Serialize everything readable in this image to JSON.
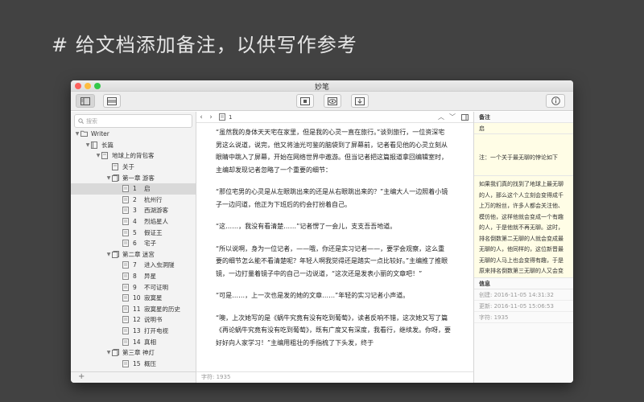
{
  "headline": "# 给文档添加备注，以供写作参考",
  "window": {
    "title": "妙笔"
  },
  "sidebar": {
    "search_placeholder": "搜索",
    "add_label": "+",
    "tree": [
      {
        "level": 0,
        "chev": "▼",
        "icon": "folder",
        "num": "",
        "label": "Writer",
        "selected": false
      },
      {
        "level": 1,
        "chev": "▼",
        "icon": "book",
        "num": "",
        "label": "长篇",
        "selected": false
      },
      {
        "level": 2,
        "chev": "▼",
        "icon": "doc",
        "num": "",
        "label": "地球上的背包客",
        "selected": false
      },
      {
        "level": 3,
        "chev": "",
        "icon": "doc",
        "num": "",
        "label": "关于",
        "selected": false
      },
      {
        "level": 3,
        "chev": "▼",
        "icon": "stack",
        "num": "",
        "label": "第一章  游客",
        "selected": false
      },
      {
        "level": 4,
        "chev": "",
        "icon": "page",
        "num": "1",
        "label": "启",
        "selected": true
      },
      {
        "level": 4,
        "chev": "",
        "icon": "page",
        "num": "2",
        "label": "杭州行",
        "selected": false
      },
      {
        "level": 4,
        "chev": "",
        "icon": "page",
        "num": "3",
        "label": "西湖游客",
        "selected": false
      },
      {
        "level": 4,
        "chev": "",
        "icon": "page",
        "num": "4",
        "label": "烈焰星人",
        "selected": false
      },
      {
        "level": 4,
        "chev": "",
        "icon": "page",
        "num": "5",
        "label": "假证王",
        "selected": false
      },
      {
        "level": 4,
        "chev": "",
        "icon": "page",
        "num": "6",
        "label": "宅子",
        "selected": false
      },
      {
        "level": 3,
        "chev": "▼",
        "icon": "stack",
        "num": "",
        "label": "第二章  迷宫",
        "selected": false
      },
      {
        "level": 4,
        "chev": "",
        "icon": "page",
        "num": "7",
        "label": "进入虫洞隧",
        "selected": false
      },
      {
        "level": 4,
        "chev": "",
        "icon": "page",
        "num": "8",
        "label": "异星",
        "selected": false
      },
      {
        "level": 4,
        "chev": "",
        "icon": "page",
        "num": "9",
        "label": "不可证明",
        "selected": false
      },
      {
        "level": 4,
        "chev": "",
        "icon": "page",
        "num": "10",
        "label": "寂寞星",
        "selected": false
      },
      {
        "level": 4,
        "chev": "",
        "icon": "page",
        "num": "11",
        "label": "寂寞星的历史",
        "selected": false
      },
      {
        "level": 4,
        "chev": "",
        "icon": "page",
        "num": "12",
        "label": "说明书",
        "selected": false
      },
      {
        "level": 4,
        "chev": "",
        "icon": "page",
        "num": "13",
        "label": "打开电视",
        "selected": false
      },
      {
        "level": 4,
        "chev": "",
        "icon": "page",
        "num": "14",
        "label": "真相",
        "selected": false
      },
      {
        "level": 3,
        "chev": "▼",
        "icon": "stack",
        "num": "",
        "label": "第三章  神灯",
        "selected": false
      },
      {
        "level": 4,
        "chev": "",
        "icon": "page",
        "num": "15",
        "label": "概压",
        "selected": false
      }
    ]
  },
  "editor": {
    "page_number": "1",
    "paragraphs": [
      "“虽然我的身体天天宅在家里，但是我的心灵一直在旅行。”谈到旅行，一位资深宅男这么说道，说完，他又将油光可鉴的脑袋到了屏幕前，记者看见他的心灵立刻从眼睛中跳入了屏幕，开始在网络世界中遨游。但当记者把这篇报道拿回编辑室时，主编却发现记者忽略了一个重要的细节：",
      "“那位宅男的心灵是从左眼跳出来的还是从右眼跳出来的？”主编大人一边照着小镜子一边问道，他正为下班后的约会打扮着自己。",
      "“这……，我没有看清楚……”记者愣了一会儿，支支吾吾地道。",
      "“所以说啊，身为一位记者，——哦，你还是实习记者——，要学会观察，这么重要的细节怎么能不看清楚呢？年轻人啊我觉得还是踏实一点比较好。”主编推了推眼镜，一边打量着镜子中的自己一边说道，“这次还是发表小丽的文章吧！”",
      "“可是……，上一次也是发的她的文章……”年轻的实习记者小声道。",
      "“噢，上次她写的是《蜗牛究竟有没有吃到葡萄》，读者反响不错，这次她又写了篇《再论蜗牛究竟有没有吃到葡萄》，既有广度又有深度，我看行，继续发。你呀，要好好向人家学习！”主编用粗壮的手指梳了下头发，终于"
    ],
    "word_count": "字符: 1935"
  },
  "notes": {
    "header": "备注",
    "title": "启",
    "note_line": "注：一个关于最无聊的悖论如下",
    "body": "如果我们真的找到了地球上最无聊的人，那么这个人立刻会变得成千上万的粉丝，许多人都会关注他、模仿他，这样他就会变成一个有趣的人，于是他就不再无聊。这时，排名倒数第二无聊的人就会变成最无聊的人，他同样的，这位新晋最无聊的人马上也会变得有趣，于是原来排名倒数第三无聊的人又会变成最无聊的人。这个过程可以如此这般循环下去，直到世界上所有的",
    "info_header": "信息",
    "created": "创建: 2016-11-05 14:31:32",
    "updated": "更新: 2016-11-05 15:06:53",
    "chars": "字符: 1935"
  }
}
